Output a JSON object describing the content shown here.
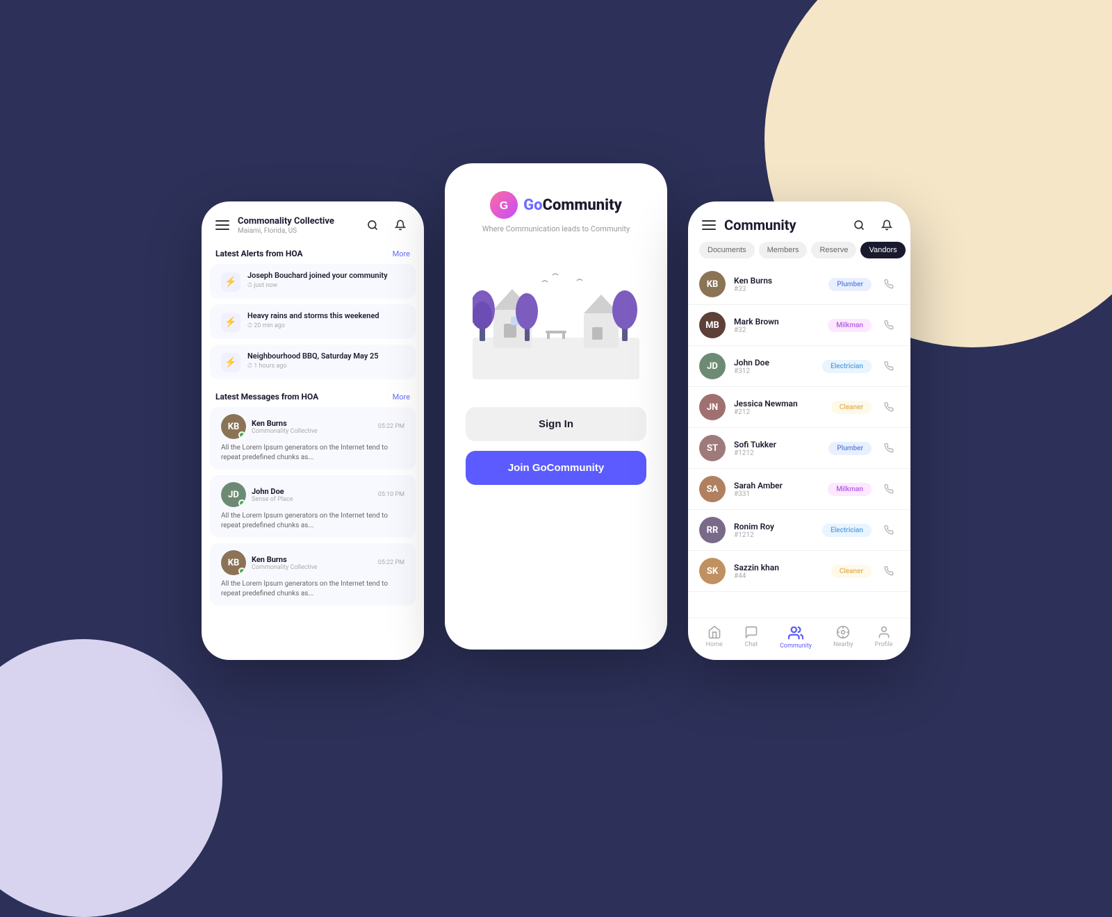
{
  "background": {
    "main_color": "#2d3159",
    "circle_top_right": "#f5e6c8",
    "circle_bottom_left": "#d8d4f0"
  },
  "phone1": {
    "header": {
      "title": "Commonality Collective",
      "subtitle": "Maiami, Florida, US",
      "search_icon": "search",
      "bell_icon": "bell",
      "menu_icon": "hamburger"
    },
    "alerts_section": {
      "title": "Latest Alerts from HOA",
      "more_label": "More",
      "items": [
        {
          "text": "Joseph Bouchard joined your community",
          "time": "just now"
        },
        {
          "text": "Heavy rains and storms this weekened",
          "time": "20 min ago"
        },
        {
          "text": "Neighbourhood BBQ, Saturday May 25",
          "time": "1 hours ago"
        }
      ]
    },
    "messages_section": {
      "title": "Latest Messages from HOA",
      "more_label": "More",
      "items": [
        {
          "name": "Ken Burns",
          "group": "Commonality Collective",
          "time": "05:22 PM",
          "text": "All the Lorem Ipsum generators on the Internet tend to repeat predefined chunks as...",
          "avatar_color": "#8B7355"
        },
        {
          "name": "John Doe",
          "group": "Sense of Place",
          "time": "05:10 PM",
          "text": "All the Lorem Ipsum generators on the Internet tend to repeat predefined chunks as...",
          "avatar_color": "#6d8b74"
        },
        {
          "name": "Ken Burns",
          "group": "Commonality Collective",
          "time": "05:22 PM",
          "text": "All the Lorem Ipsum generators on the Internet tend to repeat predefined chunks as...",
          "avatar_color": "#8B7355"
        }
      ]
    }
  },
  "phone2": {
    "logo_text_go": "Go",
    "logo_text_community": "Community",
    "tagline": "Where Communication leads to Community",
    "sign_in_label": "Sign In",
    "join_label": "Join GoCommunity"
  },
  "phone3": {
    "header": {
      "title": "Community",
      "menu_icon": "hamburger",
      "search_icon": "search",
      "bell_icon": "bell"
    },
    "tabs": [
      {
        "label": "Documents",
        "active": false
      },
      {
        "label": "Members",
        "active": false
      },
      {
        "label": "Reserve",
        "active": false
      },
      {
        "label": "Vandors",
        "active": true
      }
    ],
    "vendors": [
      {
        "name": "Ken Burns",
        "id": "#33",
        "tag": "Plumber",
        "tag_class": "tag-plumber"
      },
      {
        "name": "Mark Brown",
        "id": "#32",
        "tag": "Milkman",
        "tag_class": "tag-milkman"
      },
      {
        "name": "John Doe",
        "id": "#312",
        "tag": "Electrician",
        "tag_class": "tag-electrician"
      },
      {
        "name": "Jessica Newman",
        "id": "#212",
        "tag": "Cleaner",
        "tag_class": "tag-cleaner"
      },
      {
        "name": "Sofi Tukker",
        "id": "#1212",
        "tag": "Plumber",
        "tag_class": "tag-plumber"
      },
      {
        "name": "Sarah Amber",
        "id": "#331",
        "tag": "Milkman",
        "tag_class": "tag-milkman"
      },
      {
        "name": "Ronim Roy",
        "id": "#1212",
        "tag": "Electrician",
        "tag_class": "tag-electrician"
      },
      {
        "name": "Sazzin khan",
        "id": "#44",
        "tag": "Cleaner",
        "tag_class": "tag-cleaner"
      }
    ],
    "bottom_nav": [
      {
        "label": "Home",
        "icon": "🏠",
        "active": false
      },
      {
        "label": "Chat",
        "icon": "💬",
        "active": false
      },
      {
        "label": "Community",
        "icon": "👥",
        "active": true
      },
      {
        "label": "Nearby",
        "icon": "📍",
        "active": false
      },
      {
        "label": "Profile",
        "icon": "👤",
        "active": false
      }
    ]
  }
}
